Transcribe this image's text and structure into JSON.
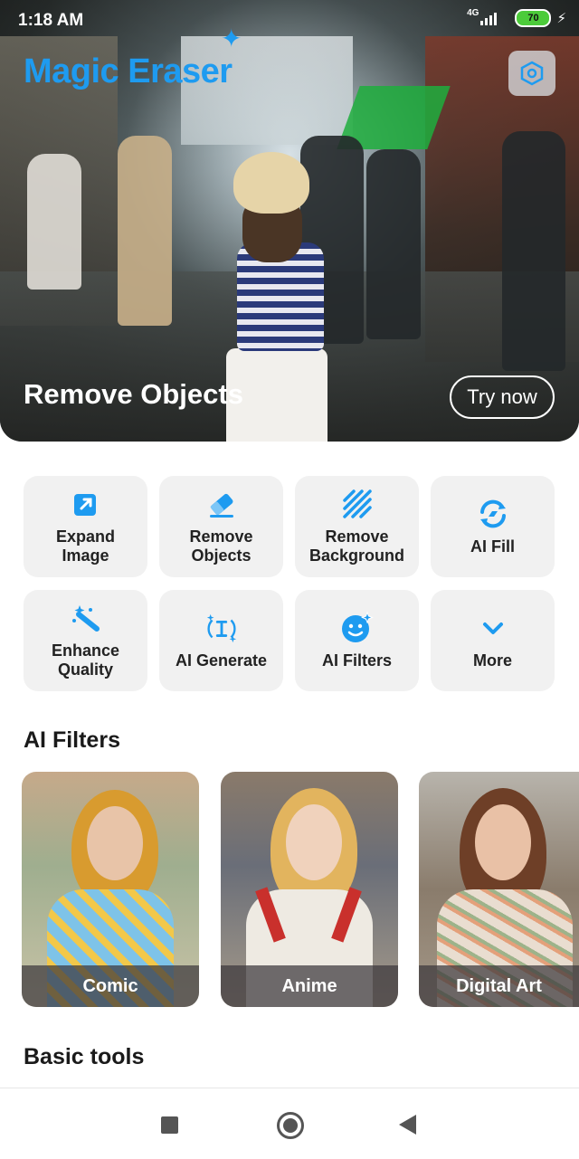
{
  "status_bar": {
    "time": "1:18 AM",
    "network": "4G",
    "battery": "70"
  },
  "header": {
    "app_title": "Magic Eraser"
  },
  "hero": {
    "caption": "Remove Objects",
    "cta_label": "Try now"
  },
  "tools": [
    {
      "label": "Expand\nImage",
      "icon": "expand-icon"
    },
    {
      "label": "Remove\nObjects",
      "icon": "eraser-icon"
    },
    {
      "label": "Remove\nBackground",
      "icon": "stripes-icon"
    },
    {
      "label": "AI Fill",
      "icon": "ai-fill-icon"
    },
    {
      "label": "Enhance\nQuality",
      "icon": "magic-wand-icon"
    },
    {
      "label": "AI Generate",
      "icon": "text-cursor-icon"
    },
    {
      "label": "AI Filters",
      "icon": "smiley-icon"
    },
    {
      "label": "More",
      "icon": "chevron-down-icon"
    }
  ],
  "filters_section": {
    "title": "AI Filters",
    "cards": [
      {
        "label": "Comic"
      },
      {
        "label": "Anime"
      },
      {
        "label": "Digital Art"
      }
    ]
  },
  "basic_tools_section": {
    "title": "Basic tools"
  },
  "colors": {
    "accent": "#1e9bf0",
    "tile_bg": "#f1f1f1"
  }
}
